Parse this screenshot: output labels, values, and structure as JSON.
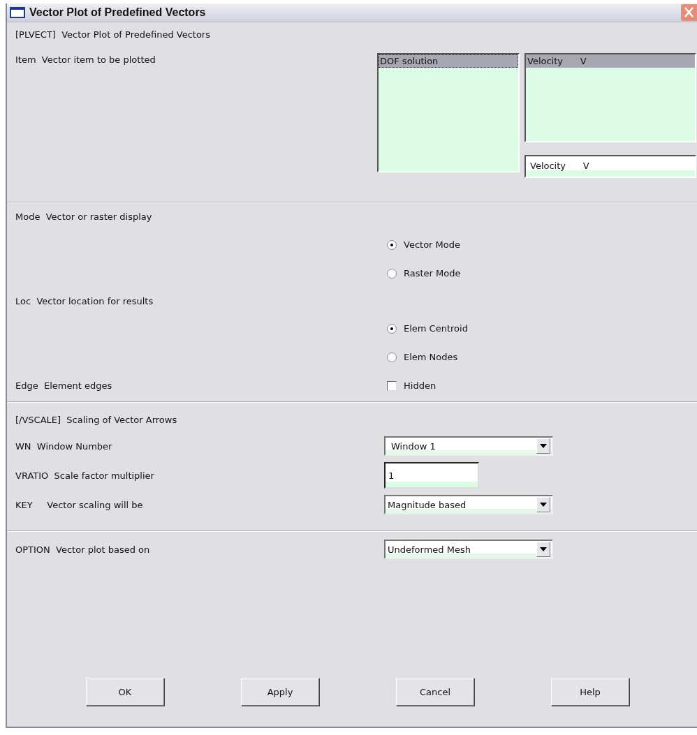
{
  "window": {
    "title": "Vector Plot of Predefined Vectors"
  },
  "plvect": {
    "header": "[PLVECT]  Vector Plot of Predefined Vectors",
    "item_label": "Item  Vector item to be plotted",
    "category_list": [
      {
        "label": "DOF solution",
        "selected": true
      }
    ],
    "component_list": [
      {
        "label": "Velocity      V",
        "selected": true
      }
    ],
    "selection_field": {
      "value": "Velocity      V"
    }
  },
  "mode": {
    "label": "Mode  Vector or raster display",
    "options": [
      {
        "label": "Vector Mode",
        "selected": true
      },
      {
        "label": "Raster Mode",
        "selected": false
      }
    ]
  },
  "loc": {
    "label": "Loc  Vector location for results",
    "options": [
      {
        "label": "Elem Centroid",
        "selected": true
      },
      {
        "label": "Elem Nodes",
        "selected": false
      }
    ]
  },
  "edge": {
    "label": "Edge  Element edges",
    "checkbox": {
      "label": "Hidden",
      "checked": false
    }
  },
  "vscale": {
    "header": "[/VSCALE]  Scaling of Vector Arrows",
    "wn": {
      "label": "WN  Window Number",
      "value": "Window 1"
    },
    "vratio": {
      "label": "VRATIO  Scale factor multiplier",
      "value": "1"
    },
    "key": {
      "label": "KEY     Vector scaling will be",
      "value": "Magnitude based"
    }
  },
  "option": {
    "label": "OPTION  Vector plot based on",
    "value": "Undeformed Mesh"
  },
  "buttons": [
    "OK",
    "Apply",
    "Cancel",
    "Help"
  ]
}
